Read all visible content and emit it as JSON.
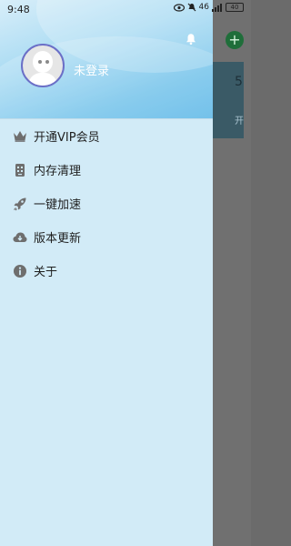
{
  "status_bar": {
    "time": "9:48",
    "signal_label": "46",
    "battery_label": "40"
  },
  "background_app": {
    "fab_icon": "+",
    "card_glyph": "5",
    "card_text": "开"
  },
  "drawer": {
    "login_label": "未登录",
    "items": [
      {
        "label": "开通VIP会员",
        "icon": "crown-icon"
      },
      {
        "label": "内存清理",
        "icon": "storage-icon"
      },
      {
        "label": "一键加速",
        "icon": "rocket-icon"
      },
      {
        "label": "版本更新",
        "icon": "cloud-download-icon"
      },
      {
        "label": "关于",
        "icon": "info-icon"
      }
    ]
  },
  "colors": {
    "drawer_bg": "#d2ebf7",
    "header_accent": "#55b4e6",
    "icon_color": "#6e6e6e",
    "scrim": "#707070"
  }
}
